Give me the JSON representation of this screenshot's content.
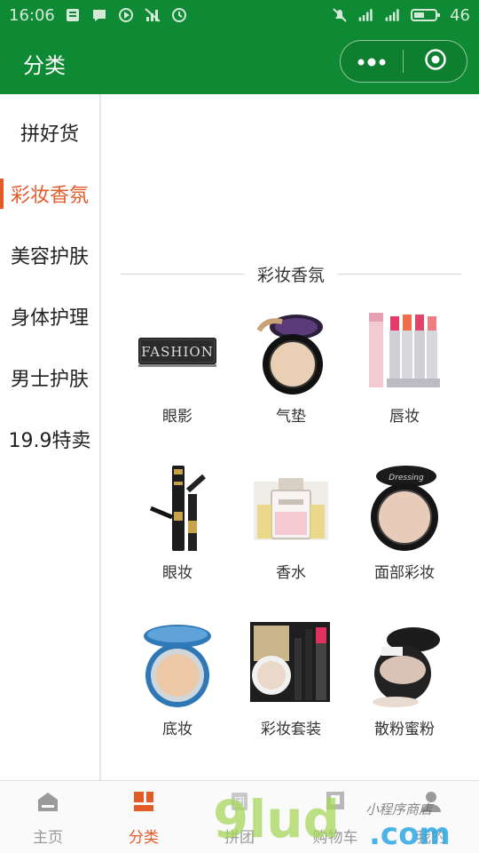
{
  "status_bar": {
    "time": "16:06",
    "battery": "46",
    "left_icons": [
      "message-icon",
      "chat-icon",
      "media-play-icon",
      "no-signal-icon",
      "clock-icon"
    ],
    "right_icons": [
      "mute-icon",
      "signal-icon",
      "signal-icon",
      "battery-icon"
    ]
  },
  "header": {
    "title": "分类",
    "menu_icon": "more-dots-icon",
    "close_icon": "target-close-icon",
    "bar_color": "#0f8a34"
  },
  "sidebar": {
    "accent": "#e45b2a",
    "items": [
      {
        "label": "拼好货",
        "active": false
      },
      {
        "label": "彩妆香氛",
        "active": true
      },
      {
        "label": "美容护肤",
        "active": false
      },
      {
        "label": "身体护理",
        "active": false
      },
      {
        "label": "男士护肤",
        "active": false
      },
      {
        "label": "19.9特卖",
        "active": false
      }
    ]
  },
  "section": {
    "title": "彩妆香氛",
    "items": [
      {
        "label": "眼影",
        "icon": "eyeshadow-palette-icon"
      },
      {
        "label": "气垫",
        "icon": "cushion-compact-icon"
      },
      {
        "label": "唇妆",
        "icon": "lipsticks-icon"
      },
      {
        "label": "眼妆",
        "icon": "mascara-icon"
      },
      {
        "label": "香水",
        "icon": "perfume-icon"
      },
      {
        "label": "面部彩妆",
        "icon": "powder-compact-icon"
      },
      {
        "label": "底妆",
        "icon": "foundation-cushion-icon"
      },
      {
        "label": "彩妆套装",
        "icon": "makeup-set-icon"
      },
      {
        "label": "散粉蜜粉",
        "icon": "loose-powder-icon"
      }
    ]
  },
  "tab_bar": {
    "tabs": [
      {
        "label": "主页",
        "icon": "home-icon",
        "active": false
      },
      {
        "label": "分类",
        "icon": "category-icon",
        "active": true
      },
      {
        "label": "拼团",
        "icon": "group-buy-icon",
        "active": false
      },
      {
        "label": "购物车",
        "icon": "cart-icon",
        "active": false
      },
      {
        "label": "我的",
        "icon": "profile-icon",
        "active": false
      }
    ]
  },
  "watermark": {
    "text": "9lud.com",
    "handwriting": "小程序商店"
  }
}
